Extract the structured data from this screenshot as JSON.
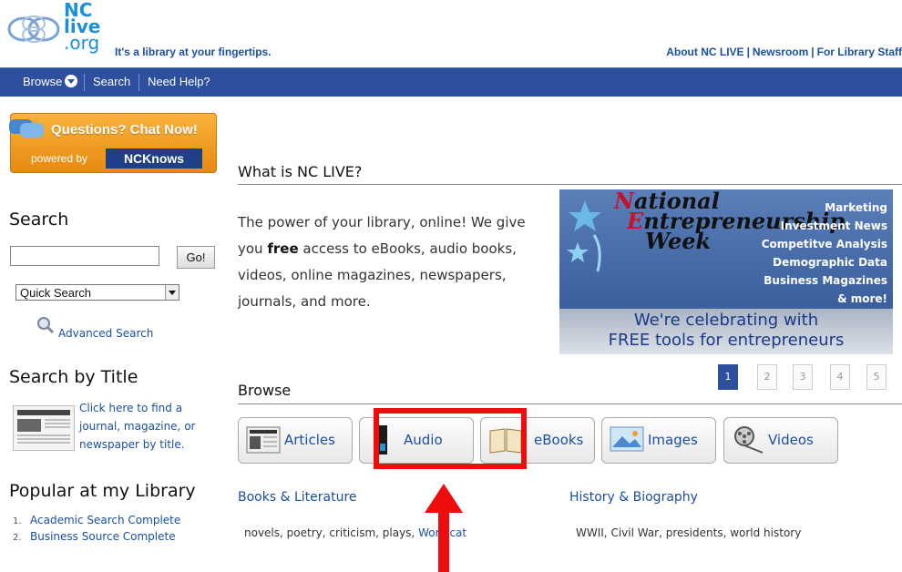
{
  "header": {
    "logo_text_lines": [
      "NC",
      "live",
      ".org"
    ],
    "tagline": "It's a library at your fingertips.",
    "top_links": [
      "About NC LIVE",
      "Newsroom",
      "For Library Staff"
    ]
  },
  "nav": {
    "browse": "Browse",
    "search": "Search",
    "help": "Need Help?"
  },
  "chat": {
    "title": "Questions? Chat Now!",
    "powered_by": "powered by",
    "brand": "NCKnows"
  },
  "left": {
    "search_heading": "Search",
    "search_value": "",
    "go_label": "Go!",
    "select_value": "Quick Search",
    "advanced_label": "Advanced Search",
    "title_heading": "Search by Title",
    "title_link": "Click here to find a journal, magazine, or newspaper by title.",
    "popular_heading": "Popular at my Library",
    "popular_items": [
      {
        "n": "1.",
        "label": "Academic Search Complete"
      },
      {
        "n": "2.",
        "label": "Business Source Complete"
      }
    ]
  },
  "main": {
    "what_heading": "What is NC LIVE?",
    "intro_prefix": "The power of your library, online! We give you ",
    "intro_bold": "free",
    "intro_suffix": " access to eBooks, audio books, videos, online magazines, newspapers, journals, and more.",
    "banner": {
      "line1a": "N",
      "line1b": "ational",
      "line2a": "E",
      "line2b": "ntrepreneurship",
      "line3": "Week",
      "list": [
        "Marketing",
        "Investment News",
        "Competitve Analysis",
        "Demographic Data",
        "Business Magazines",
        "& more!"
      ],
      "celebrate1": "We're celebrating with",
      "celebrate2": "FREE tools for entrepreneurs"
    },
    "pager": [
      "1",
      "2",
      "3",
      "4",
      "5"
    ],
    "pager_active": "1",
    "browse_heading": "Browse",
    "browse_buttons": [
      "Articles",
      "Audio",
      "eBooks",
      "Images",
      "Videos"
    ],
    "categories": [
      {
        "title": "Books & Literature",
        "desc": "novels, poetry, criticism, plays, ",
        "link": "Worldcat"
      },
      {
        "title": "History & Biography",
        "desc": "WWII, Civil War, presidents, world history"
      }
    ]
  },
  "colors": {
    "nav_bg": "#2e4f9e",
    "link": "#1a4fa0",
    "highlight": "#ee0d0d",
    "chat_orange": "#f39a1e"
  }
}
